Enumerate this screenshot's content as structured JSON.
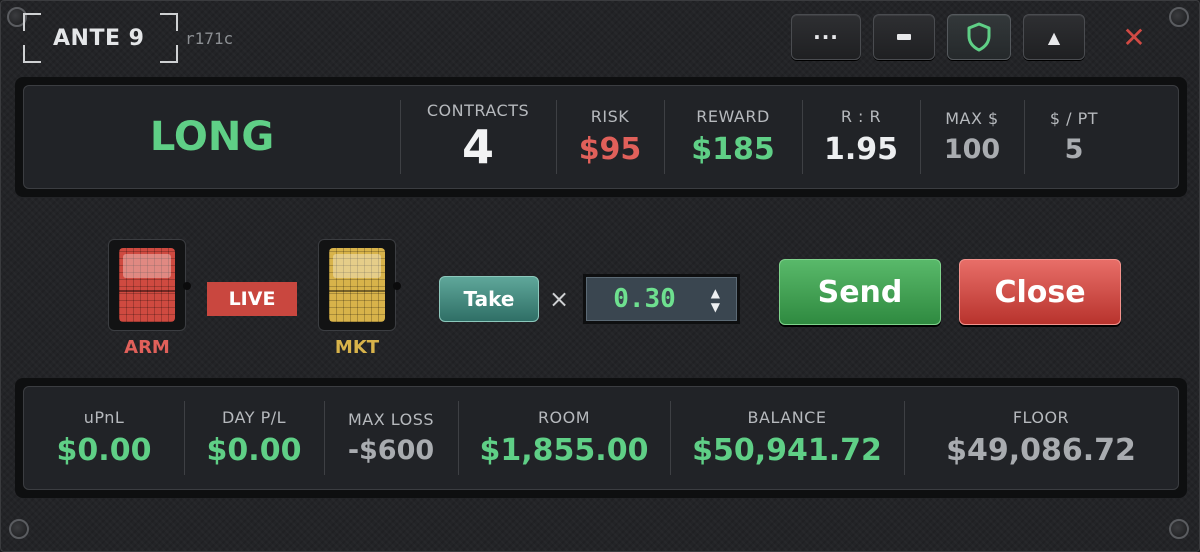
{
  "window": {
    "title": "ANTE 9",
    "version": "r171c",
    "buttons": {
      "more": "···",
      "up": "▲",
      "close": "✕"
    }
  },
  "position": {
    "side": "LONG",
    "contracts_label": "CONTRACTS",
    "contracts": "4",
    "risk_label": "RISK",
    "risk": "$95",
    "reward_label": "REWARD",
    "reward": "$185",
    "rr_label": "R : R",
    "rr": "1.95",
    "max_label": "MAX $",
    "max": "100",
    "ppt_label": "$ / PT",
    "ppt": "5"
  },
  "controls": {
    "arm_label": "ARM",
    "live_label": "LIVE",
    "mkt_label": "MKT",
    "take_label": "Take",
    "times": "×",
    "multiplier": "0.30",
    "send_label": "Send",
    "close_label": "Close"
  },
  "account": {
    "upnl_label": "uPnL",
    "upnl": "$0.00",
    "day_label": "DAY P/L",
    "day": "$0.00",
    "maxloss_label": "MAX LOSS",
    "maxloss": "-$600",
    "room_label": "ROOM",
    "room": "$1,855.00",
    "balance_label": "BALANCE",
    "balance": "$50,941.72",
    "floor_label": "FLOOR",
    "floor": "$49,086.72"
  },
  "colors": {
    "green": "#5fcf86",
    "red": "#e0605a",
    "arm": "#cf4a40",
    "mkt": "#d8b34a",
    "take": "#2f6f66"
  }
}
